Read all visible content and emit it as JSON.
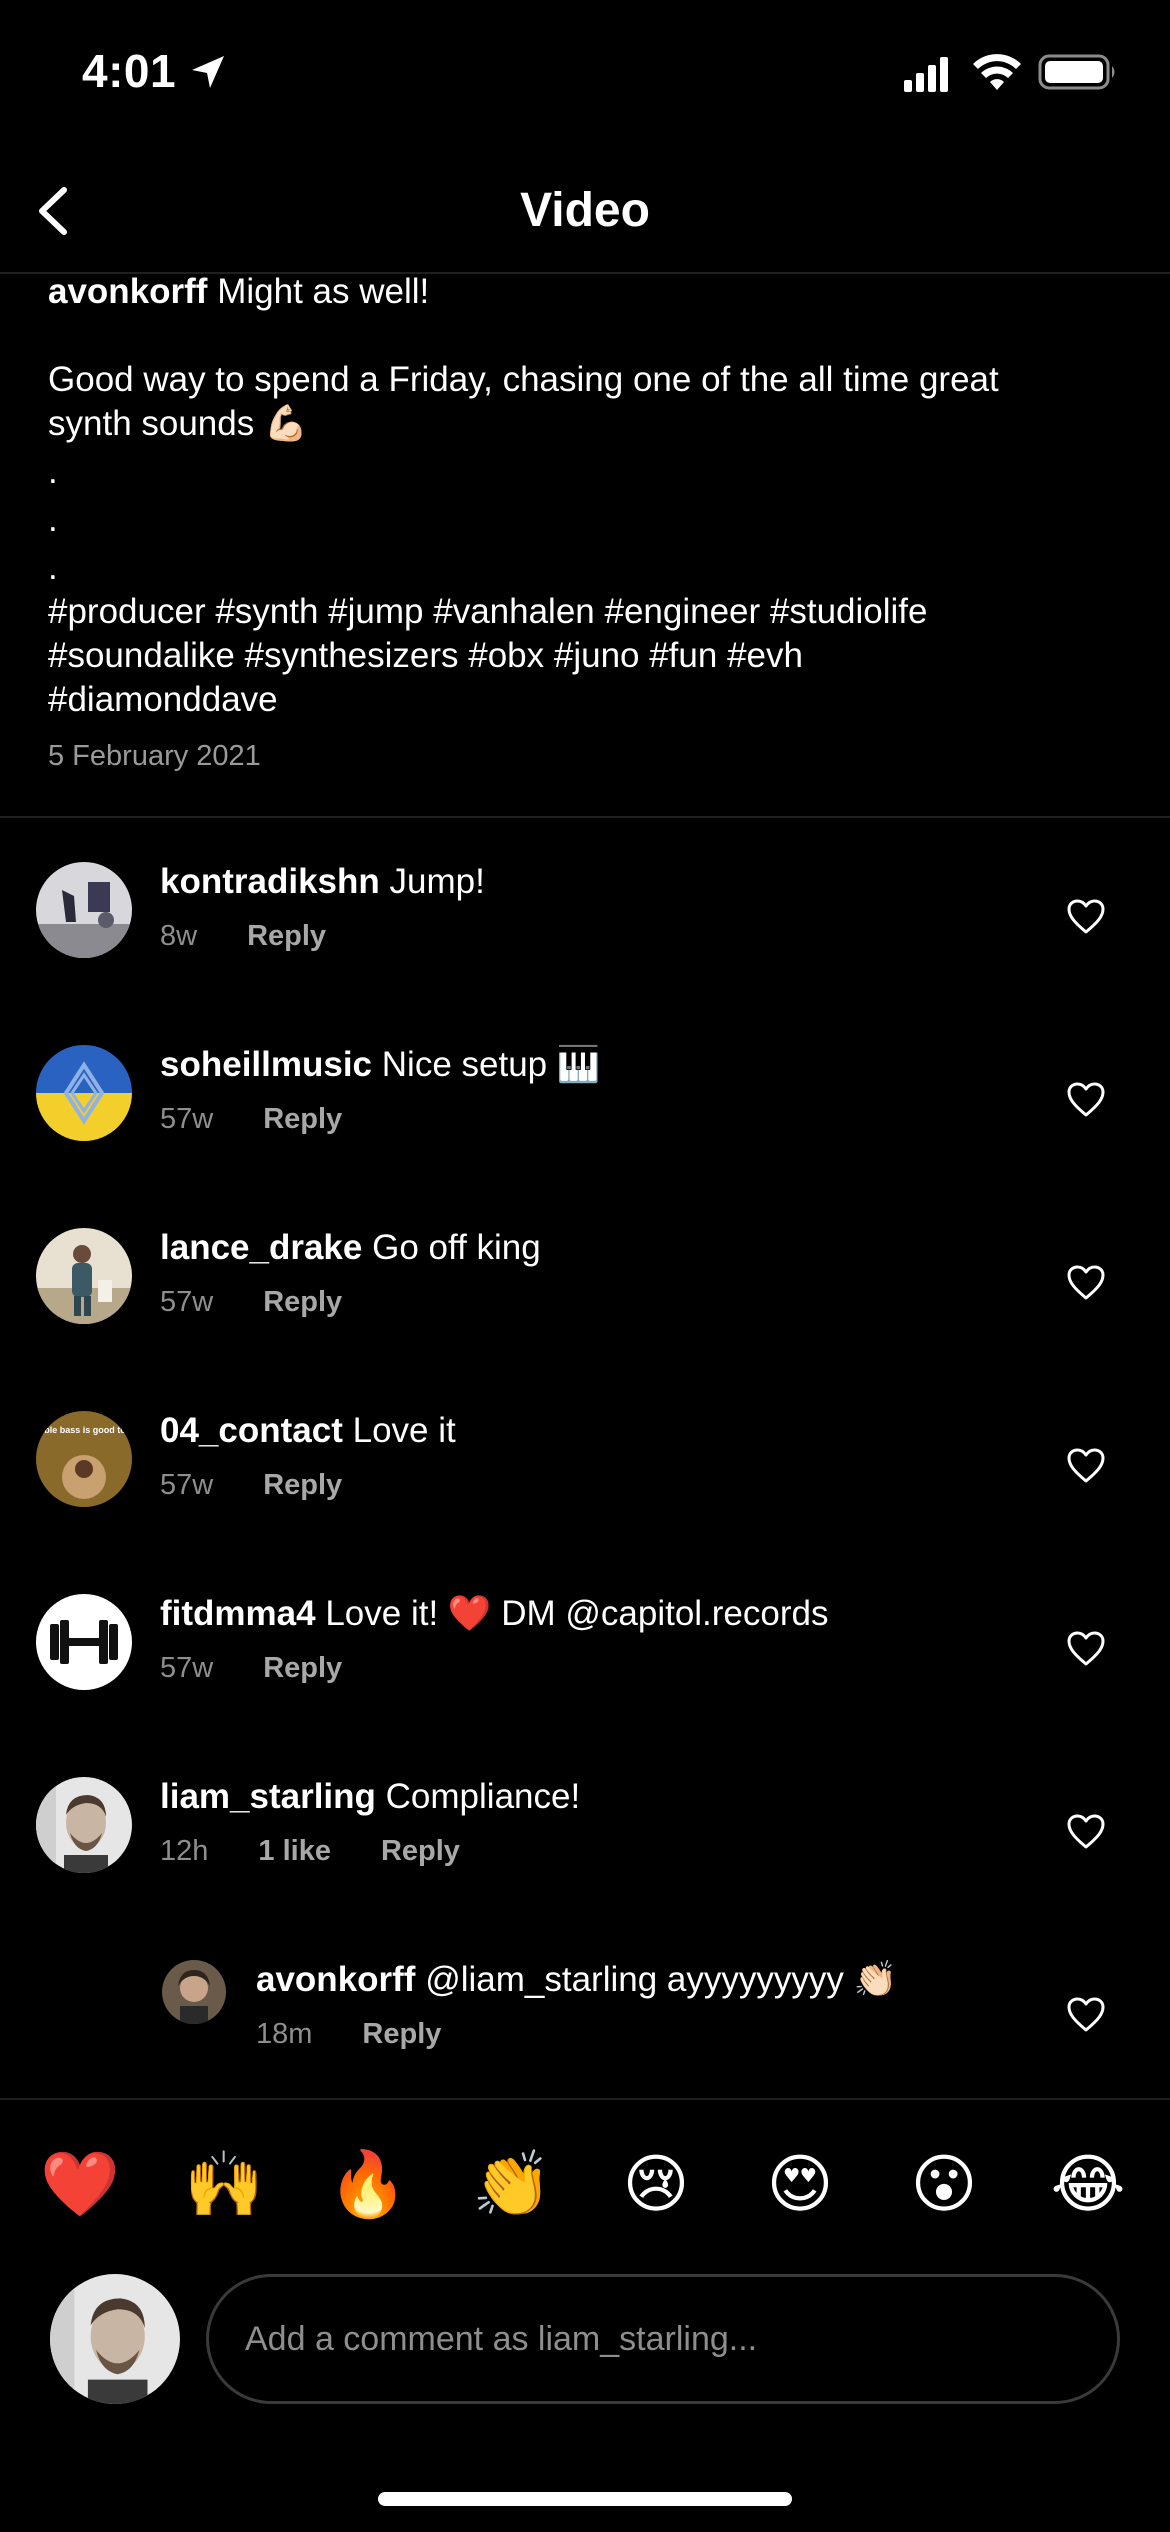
{
  "status_bar": {
    "time": "4:01"
  },
  "nav": {
    "title": "Video"
  },
  "caption": {
    "user": "avonkorff",
    "first_line": "Might as well!",
    "line2": "Good way to spend a Friday, chasing one of the all time great",
    "line3": "synth sounds 💪🏻",
    "dot1": ".",
    "dot2": ".",
    "dot3": ".",
    "tags1": "#producer #synth #jump #vanhalen #engineer #studiolife",
    "tags2": "#soundalike #synthesizers #obx #juno #fun #evh",
    "tags3": "#diamonddave",
    "date": "5 February 2021"
  },
  "comments": [
    {
      "user": "kontradikshn",
      "text": "Jump!",
      "age": "8w",
      "likes": "",
      "reply": "Reply"
    },
    {
      "user": "soheillmusic",
      "text": "Nice setup 🎹",
      "age": "57w",
      "likes": "",
      "reply": "Reply"
    },
    {
      "user": "lance_drake",
      "text": "Go off king",
      "age": "57w",
      "likes": "",
      "reply": "Reply"
    },
    {
      "user": "04_contact",
      "text": "Love it",
      "age": "57w",
      "likes": "",
      "reply": "Reply"
    },
    {
      "user": "fitdmma4",
      "text": "Love it! ❤️ DM @capitol.records",
      "age": "57w",
      "likes": "",
      "reply": "Reply"
    },
    {
      "user": "liam_starling",
      "text": "Compliance!",
      "age": "12h",
      "likes": "1 like",
      "reply": "Reply"
    },
    {
      "user": "avonkorff",
      "text": "@liam_starling ayyyyyyyyy 👏🏻",
      "age": "18m",
      "likes": "",
      "reply": "Reply"
    }
  ],
  "avatar_2_text": "Double bass is good today",
  "emojis": [
    "❤️",
    "🙌",
    "🔥",
    "👏",
    "😢",
    "😍",
    "😮",
    "😂"
  ],
  "input": {
    "placeholder": "Add a comment as liam_starling..."
  },
  "colors": {
    "background": "#000000",
    "secondary_text": "#8e8e8e",
    "divider": "#1f1f1f"
  }
}
